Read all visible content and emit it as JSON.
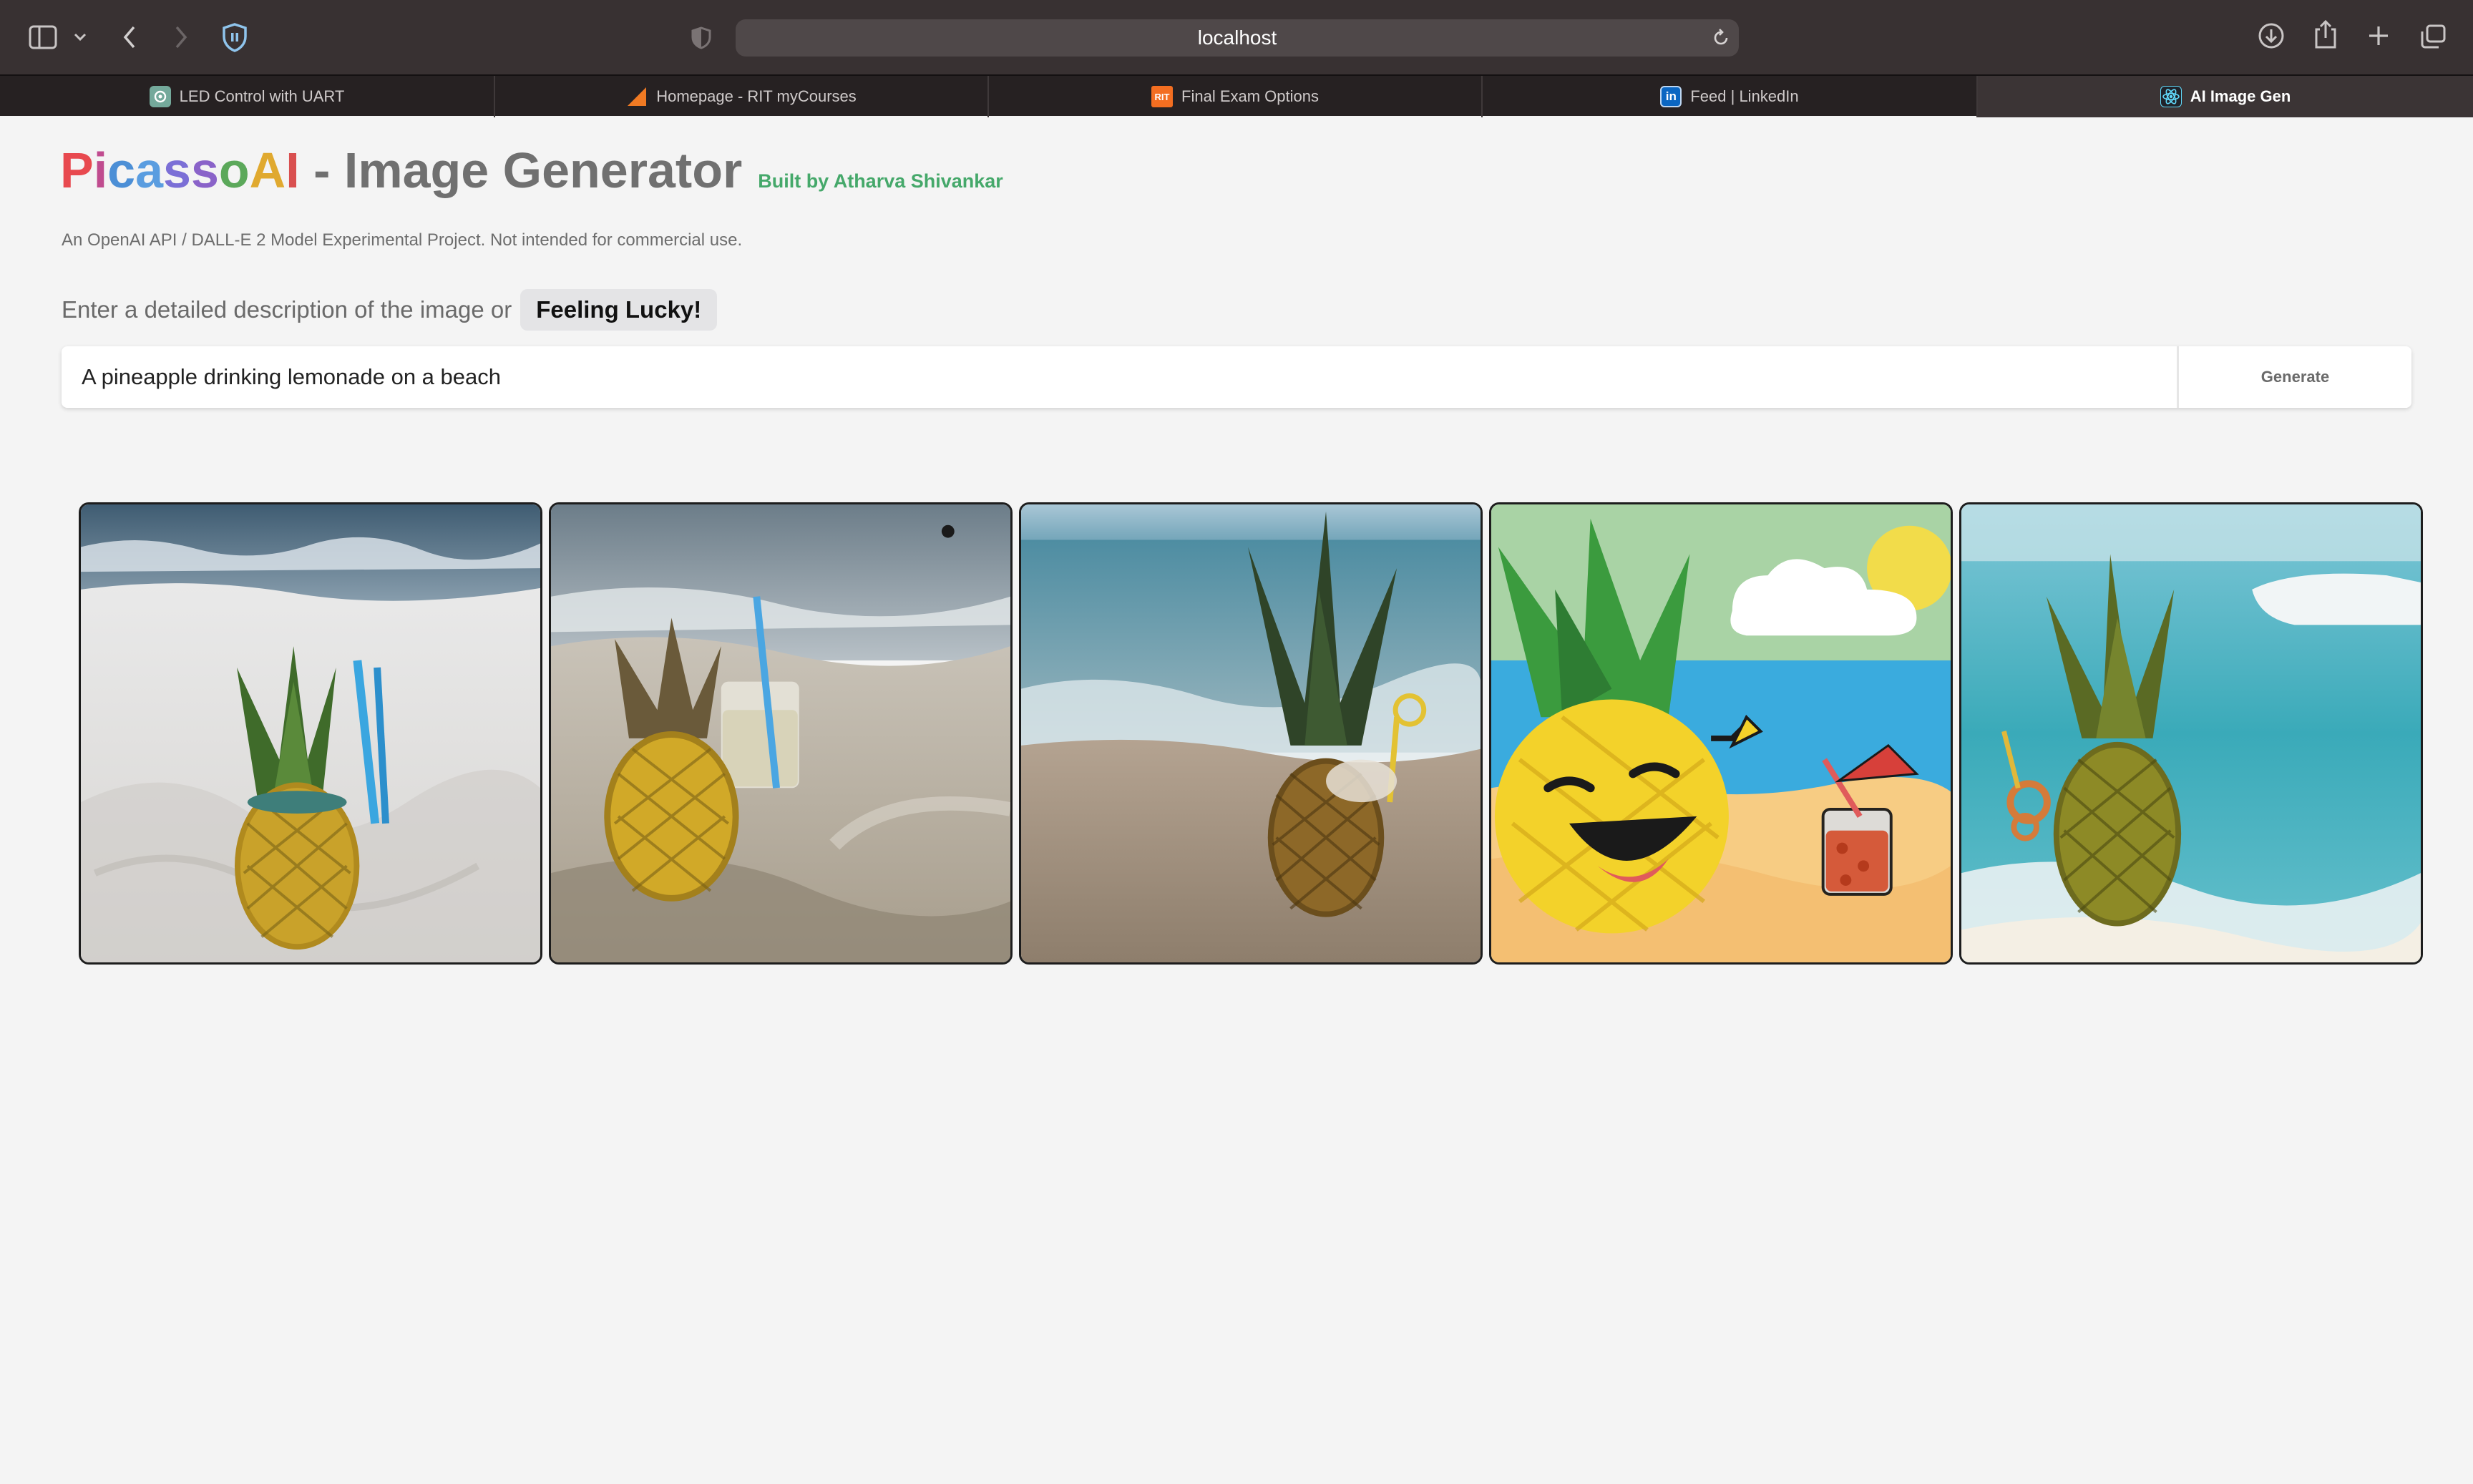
{
  "browser": {
    "url": "localhost",
    "tabs": [
      {
        "label": "LED Control with UART",
        "favicon": "chatgpt-icon",
        "color": "#74a99b"
      },
      {
        "label": "Homepage - RIT myCourses",
        "favicon": "mycourses-icon",
        "color": "#f07a23"
      },
      {
        "label": "Final Exam Options",
        "favicon": "rit-icon",
        "color": "#f36e21"
      },
      {
        "label": "Feed | LinkedIn",
        "favicon": "linkedin-icon",
        "color": "#0a66c2"
      },
      {
        "label": "AI Image Gen",
        "favicon": "react-icon",
        "color": "#61dafb",
        "active": true
      }
    ]
  },
  "header": {
    "brand_letters": [
      "P",
      "i",
      "c",
      "a",
      "s",
      "s",
      "o",
      "A",
      "I"
    ],
    "brand_colors": [
      "#e8494f",
      "#c04c8f",
      "#4c8fd6",
      "#5a9de0",
      "#7b6fd6",
      "#8a63c9",
      "#5ba85a",
      "#e0a92f",
      "#d94f4f"
    ],
    "title_rest": " - Image Generator",
    "built_by": "Built by Atharva Shivankar",
    "subtitle": "An OpenAI API / DALL-E 2 Model Experimental Project. Not intended for commercial use."
  },
  "prompt": {
    "label": "Enter a detailed description of the image or",
    "lucky_label": "Feeling Lucky!",
    "value": "A pineapple drinking lemonade on a beach",
    "generate_label": "Generate"
  },
  "images": [
    {
      "name": "generated-image-1",
      "scene": "pineapple with blue straws on white sand"
    },
    {
      "name": "generated-image-2",
      "scene": "pineapple beside lemonade cup in sand"
    },
    {
      "name": "generated-image-3",
      "scene": "pineapple with yellow straw at waters edge"
    },
    {
      "name": "generated-image-4",
      "scene": "cartoon laughing pineapple with red drink"
    },
    {
      "name": "generated-image-5",
      "scene": "pineapple with straw on turquoise sea"
    }
  ]
}
